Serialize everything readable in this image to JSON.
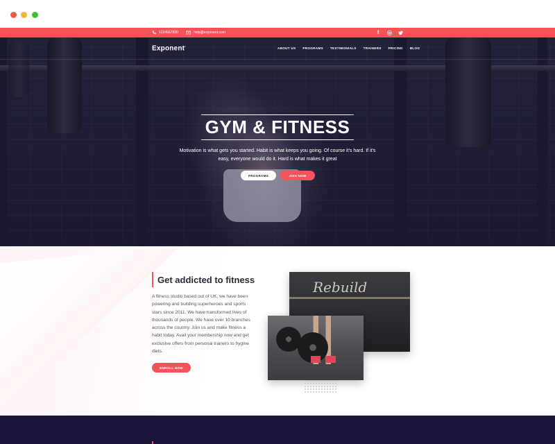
{
  "topbar": {
    "phone": "1234567890",
    "email": "help@exponent.com",
    "social_icons": [
      "facebook-icon",
      "instagram-icon",
      "twitter-icon"
    ]
  },
  "nav": {
    "logo": "Exponent",
    "items": [
      {
        "label": "ABOUT US"
      },
      {
        "label": "PROGRAMS"
      },
      {
        "label": "TESTIMONIALS"
      },
      {
        "label": "TRAINERS"
      },
      {
        "label": "PRICING"
      },
      {
        "label": "BLOG"
      }
    ]
  },
  "hero": {
    "title": "GYM & FITNESS",
    "subtitle": "Motivation is what gets you started. Habit is what keeps you going. Of course it's hard. If it's easy, everyone would do it. Hard is what makes it great",
    "button_primary": "PROGRAMS",
    "button_secondary": "JOIN NOW"
  },
  "about": {
    "title": "Get addicted to fitness",
    "text": "A fitness studio based out of UK, we have been powering and building superheroes and sports stars since 2011. We have transformed lives of thousands of people. We have over 10 branches across the country. Join us and make fitness a habit today. Avail your membership now and get exclusive offers from personal trainers to hygine diets.",
    "button": "ENROLL NOW"
  },
  "colors": {
    "accent": "#f5535a",
    "hero_overlay": "#1e1b3a",
    "footer_band": "#1b1438"
  }
}
